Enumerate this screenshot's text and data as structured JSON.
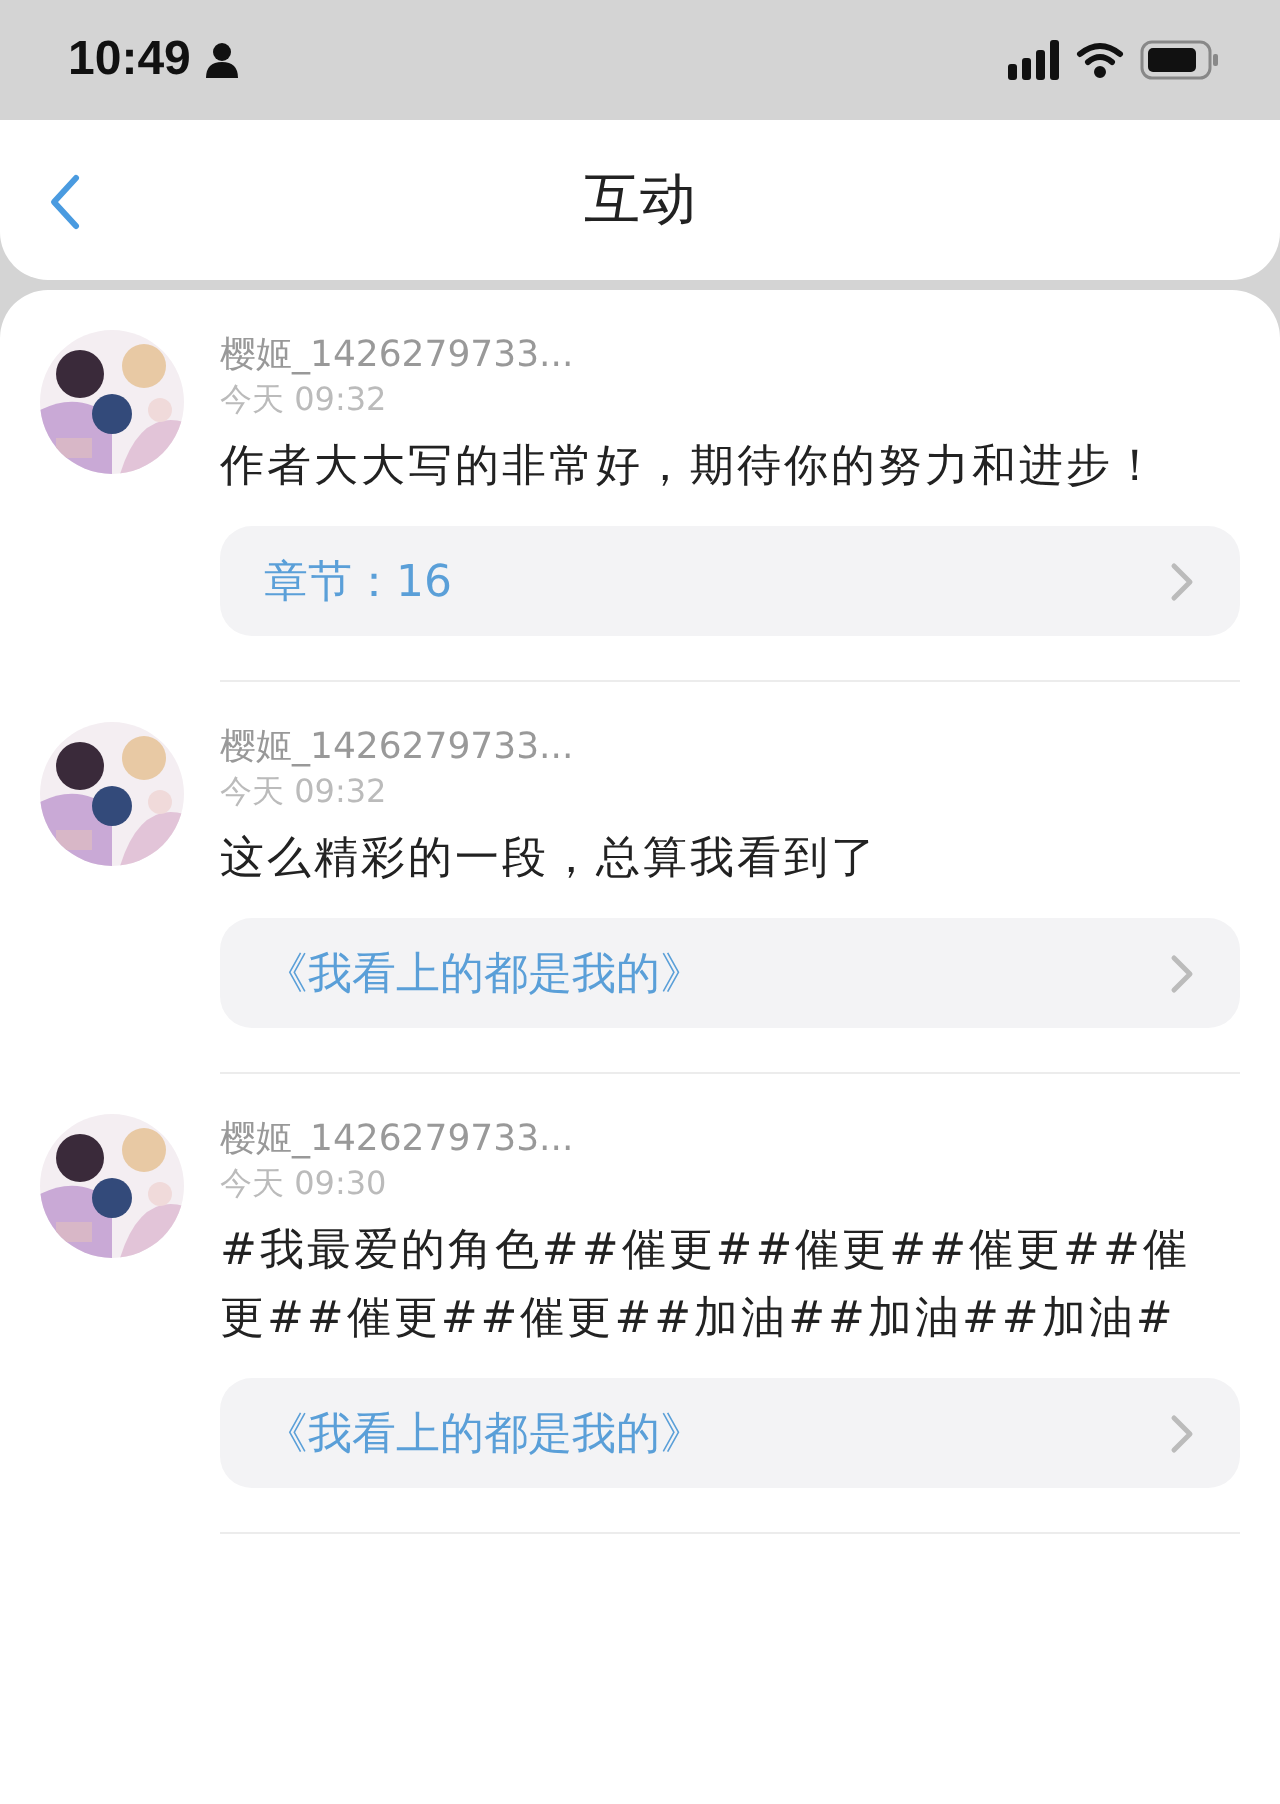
{
  "status_bar": {
    "time": "10:49"
  },
  "header": {
    "title": "互动"
  },
  "comments": [
    {
      "user": "樱姬_1426279733...",
      "time": "今天 09:32",
      "text": "作者大大写的非常好，期待你的努力和进步！",
      "link": "章节：16"
    },
    {
      "user": "樱姬_1426279733...",
      "time": "今天 09:32",
      "text": "这么精彩的一段，总算我看到了",
      "link": "《我看上的都是我的》"
    },
    {
      "user": "樱姬_1426279733...",
      "time": "今天 09:30",
      "text": "#我最爱的角色##催更##催更##催更##催更##催更##催更##加油##加油##加油#",
      "link": "《我看上的都是我的》"
    }
  ]
}
